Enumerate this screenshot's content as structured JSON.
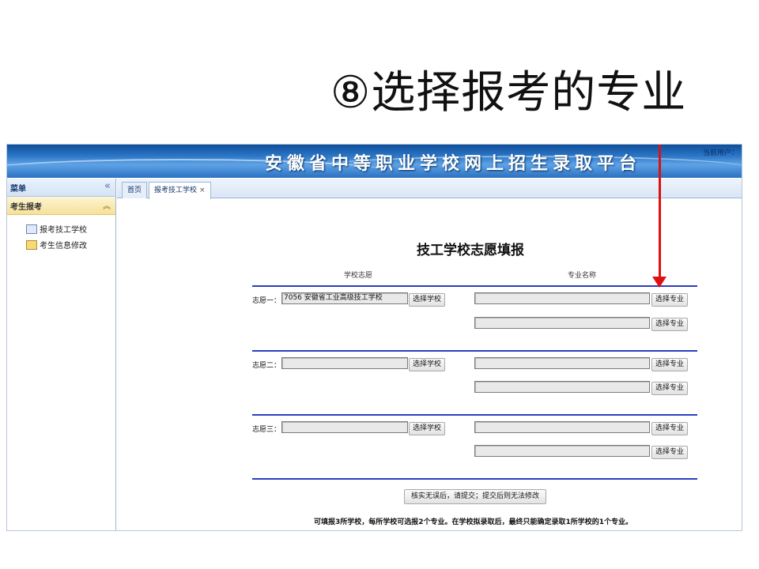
{
  "slide_title": "⑧选择报考的专业",
  "header": {
    "banner_title": "安徽省中等职业学校网上招生录取平台",
    "current_user": "当前用户："
  },
  "sidebar": {
    "title": "菜单",
    "collapse_icon": "«",
    "group_title": "考生报考",
    "group_icon": "≈",
    "items": [
      {
        "label": "报考技工学校",
        "icon": "table-icon"
      },
      {
        "label": "考生信息修改",
        "icon": "edit-icon"
      }
    ]
  },
  "tabs": [
    {
      "label": "首页"
    },
    {
      "label": "报考技工学校",
      "close": "×"
    }
  ],
  "form": {
    "title": "技工学校志愿填报",
    "col_school": "学校志愿",
    "col_major": "专业名称",
    "choices": [
      {
        "label": "志愿一：",
        "school_value": "7056 安徽省工业高级技工学校",
        "school_button": "选择学校",
        "major_button_1": "选择专业",
        "major_button_2": "选择专业"
      },
      {
        "label": "志愿二：",
        "school_value": "",
        "school_button": "选择学校",
        "major_button_1": "选择专业",
        "major_button_2": "选择专业"
      },
      {
        "label": "志愿三：",
        "school_value": "",
        "school_button": "选择学校",
        "major_button_1": "选择专业",
        "major_button_2": "选择专业"
      }
    ],
    "submit_label": "核实无误后，请提交；提交后则无法修改",
    "note": "可填报3所学校，每所学校可选报2个专业。在学校拟录取后，最终只能确定录取1所学校的1个专业。"
  },
  "annotation": {
    "arrow_color": "#e01010"
  }
}
